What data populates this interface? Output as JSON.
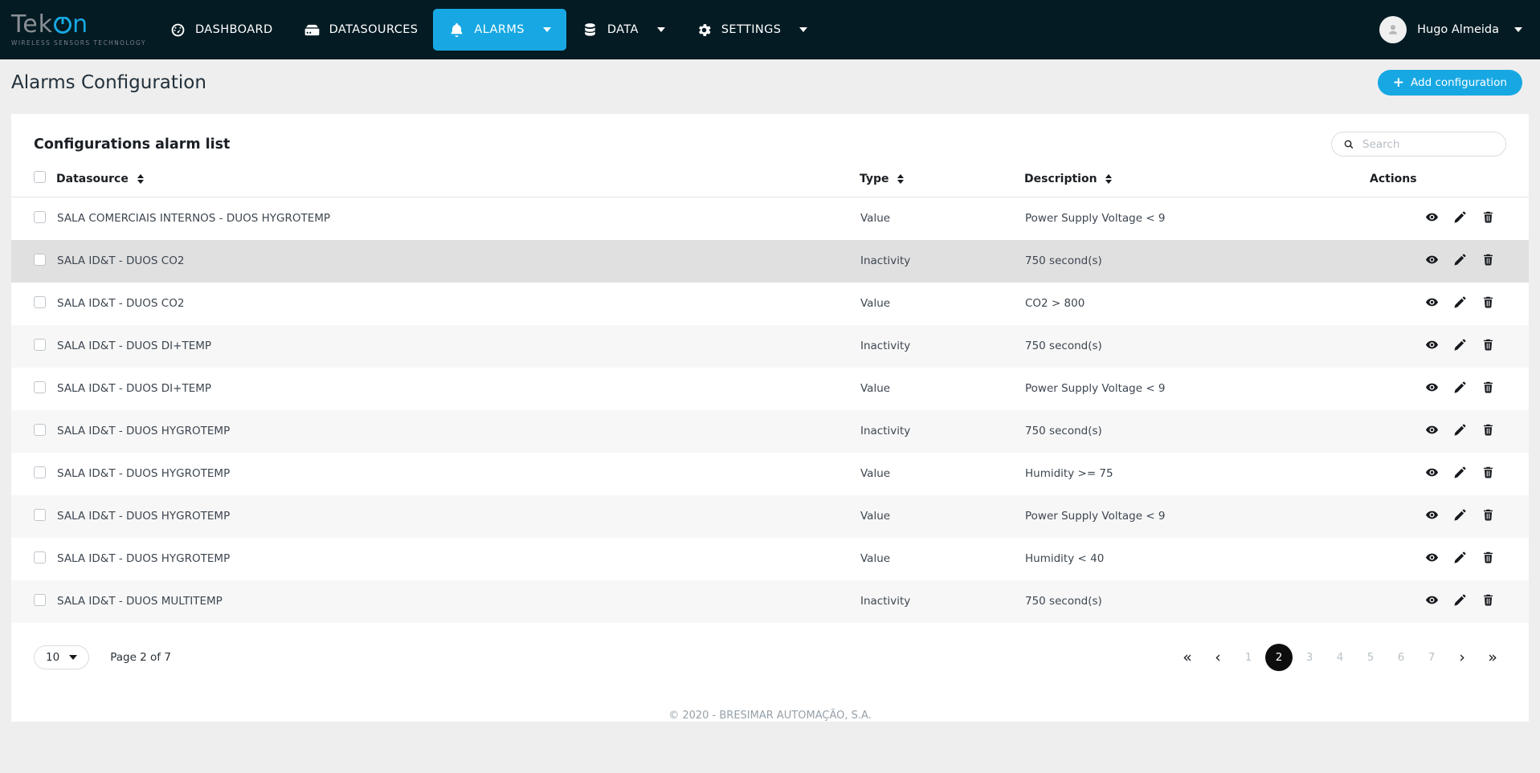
{
  "colors": {
    "navbar_bg": "#041b23",
    "accent": "#17a8e3",
    "page_bg": "#eeeeee",
    "card_bg": "#ffffff",
    "zebra_row": "#f7f7f7",
    "hover_row": "#e0e0e0",
    "active_page_bg": "#0d0d0d"
  },
  "navbar": {
    "logo": {
      "primary": "Tek",
      "secondary": "n",
      "tagline": "WIRELESS SENSORS TECHNOLOGY"
    },
    "items": [
      {
        "label": "DASHBOARD",
        "icon": "gauge-icon",
        "active": false,
        "has_caret": false
      },
      {
        "label": "DATASOURCES",
        "icon": "server-icon",
        "active": false,
        "has_caret": false
      },
      {
        "label": "ALARMS",
        "icon": "bell-icon",
        "active": true,
        "has_caret": true
      },
      {
        "label": "DATA",
        "icon": "database-icon",
        "active": false,
        "has_caret": true
      },
      {
        "label": "SETTINGS",
        "icon": "gear-icon",
        "active": false,
        "has_caret": true
      }
    ],
    "user": {
      "name": "Hugo Almeida",
      "avatar_icon": "user-icon",
      "caret_icon": "chevron-down-icon"
    }
  },
  "page": {
    "title": "Alarms Configuration",
    "add_button": {
      "label": "Add configuration",
      "icon": "plus-icon"
    }
  },
  "card": {
    "title": "Configurations alarm list",
    "search": {
      "placeholder": "Search",
      "value": "",
      "icon": "search-icon"
    }
  },
  "table": {
    "columns": [
      {
        "key": "datasource",
        "label": "Datasource",
        "sortable": true
      },
      {
        "key": "type",
        "label": "Type",
        "sortable": true
      },
      {
        "key": "description",
        "label": "Description",
        "sortable": true
      },
      {
        "key": "actions",
        "label": "Actions",
        "sortable": false
      }
    ],
    "action_icons": [
      "eye-icon",
      "pencil-icon",
      "trash-icon"
    ],
    "rows": [
      {
        "datasource": "SALA COMERCIAIS INTERNOS - DUOS HYGROTEMP",
        "type": "Value",
        "description": "Power Supply Voltage < 9",
        "checked": false,
        "highlighted": false
      },
      {
        "datasource": "SALA ID&T - DUOS CO2",
        "type": "Inactivity",
        "description": "750 second(s)",
        "checked": false,
        "highlighted": true
      },
      {
        "datasource": "SALA ID&T - DUOS CO2",
        "type": "Value",
        "description": "CO2 > 800",
        "checked": false,
        "highlighted": false
      },
      {
        "datasource": "SALA ID&T - DUOS DI+TEMP",
        "type": "Inactivity",
        "description": "750 second(s)",
        "checked": false,
        "highlighted": false
      },
      {
        "datasource": "SALA ID&T - DUOS DI+TEMP",
        "type": "Value",
        "description": "Power Supply Voltage < 9",
        "checked": false,
        "highlighted": false
      },
      {
        "datasource": "SALA ID&T - DUOS HYGROTEMP",
        "type": "Inactivity",
        "description": "750 second(s)",
        "checked": false,
        "highlighted": false
      },
      {
        "datasource": "SALA ID&T - DUOS HYGROTEMP",
        "type": "Value",
        "description": "Humidity >= 75",
        "checked": false,
        "highlighted": false
      },
      {
        "datasource": "SALA ID&T - DUOS HYGROTEMP",
        "type": "Value",
        "description": "Power Supply Voltage < 9",
        "checked": false,
        "highlighted": false
      },
      {
        "datasource": "SALA ID&T - DUOS HYGROTEMP",
        "type": "Value",
        "description": "Humidity < 40",
        "checked": false,
        "highlighted": false
      },
      {
        "datasource": "SALA ID&T - DUOS MULTITEMP",
        "type": "Inactivity",
        "description": "750 second(s)",
        "checked": false,
        "highlighted": false
      }
    ]
  },
  "pagination": {
    "page_size": "10",
    "page_label": "Page 2 of 7",
    "first_icon": "double-chevron-left-icon",
    "prev_icon": "chevron-left-icon",
    "next_icon": "chevron-right-icon",
    "last_icon": "double-chevron-right-icon",
    "pages": [
      "1",
      "2",
      "3",
      "4",
      "5",
      "6",
      "7"
    ],
    "current_page": "2"
  },
  "footer": {
    "text": "© 2020 - BRESIMAR AUTOMAÇÃO, S.A."
  }
}
